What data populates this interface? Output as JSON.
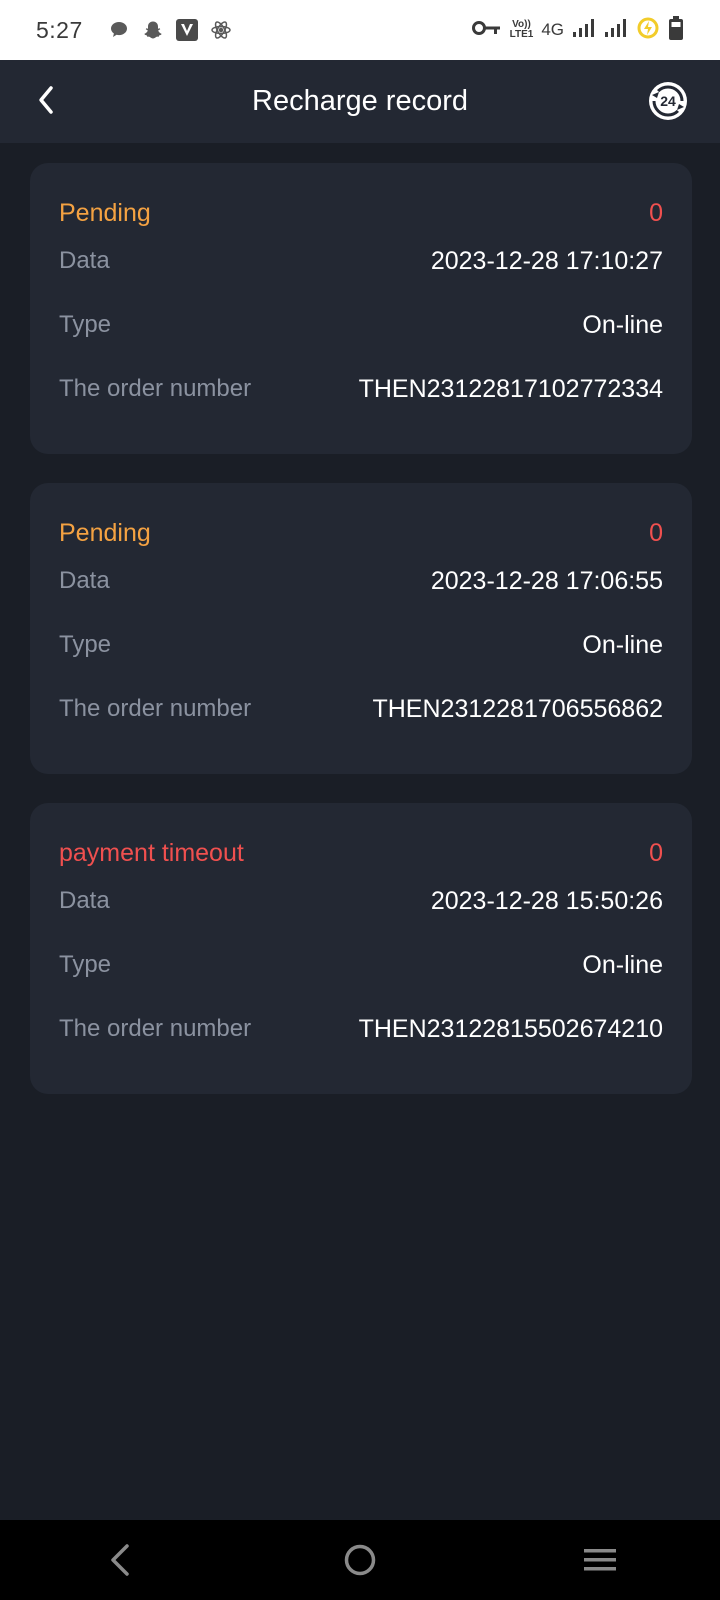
{
  "status_bar": {
    "time": "5:27",
    "notification_icons": [
      "chat-bubble-icon",
      "snapchat-icon",
      "v-app-icon",
      "atom-icon"
    ],
    "volte_top": "Vo))",
    "volte_bottom": "LTE1",
    "network": "4G",
    "system_icons": [
      "vpn-key-icon",
      "signal-icon",
      "signal-icon",
      "data-saver-icon",
      "battery-icon"
    ]
  },
  "header": {
    "title": "Recharge record",
    "back_icon": "chevron-left-icon",
    "support_icon": "24h-support-icon"
  },
  "records": [
    {
      "status": "Pending",
      "status_type": "pending",
      "amount": "0",
      "date_label": "Data",
      "date_value": "2023-12-28 17:10:27",
      "type_label": "Type",
      "type_value": "On-line",
      "order_label": "The order number",
      "order_value": "THEN23122817102772334"
    },
    {
      "status": "Pending",
      "status_type": "pending",
      "amount": "0",
      "date_label": "Data",
      "date_value": "2023-12-28 17:06:55",
      "type_label": "Type",
      "type_value": "On-line",
      "order_label": "The order number",
      "order_value": "THEN2312281706556862"
    },
    {
      "status": "payment timeout",
      "status_type": "timeout",
      "amount": "0",
      "date_label": "Data",
      "date_value": "2023-12-28 15:50:26",
      "type_label": "Type",
      "type_value": "On-line",
      "order_label": "The order number",
      "order_value": "THEN23122815502674210"
    }
  ],
  "nav_bar": {
    "icons": [
      "back-triangle-icon",
      "home-circle-icon",
      "menu-lines-icon"
    ]
  },
  "colors": {
    "background": "#1a1e26",
    "card": "#232833",
    "pending": "#f4a242",
    "timeout": "#f0504f",
    "label": "#8b92a0"
  }
}
